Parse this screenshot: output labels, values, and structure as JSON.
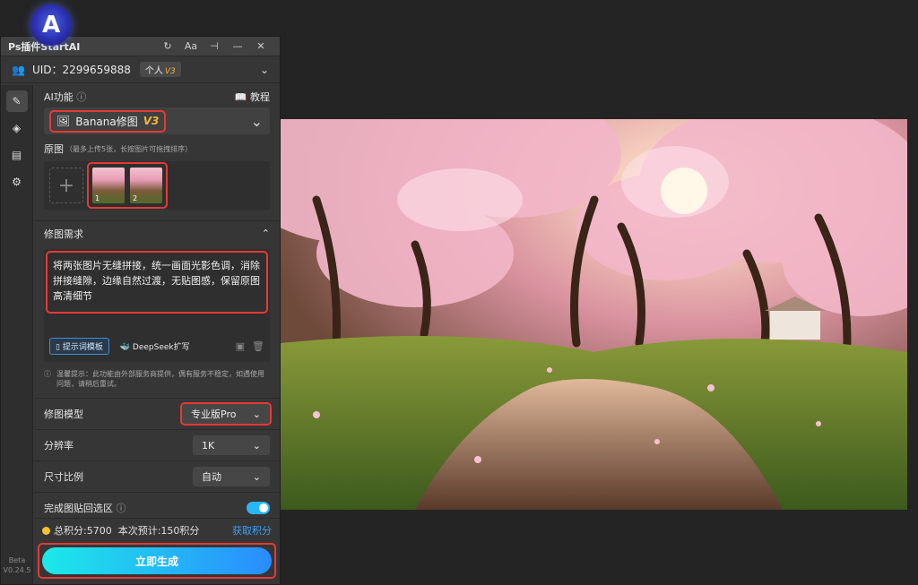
{
  "logo": {
    "letter": "A"
  },
  "window": {
    "title": "Ps插件StartAI"
  },
  "user": {
    "uid": "UID：2299659888",
    "plan": "个人",
    "plan_version": "V3"
  },
  "sidebar": {
    "version_line1": "Beta",
    "version_line2": "V0.24.5"
  },
  "ai": {
    "label": "AI功能",
    "tutorial": "教程",
    "model_name": "Banana修图",
    "model_version": "V3"
  },
  "original": {
    "label": "原图",
    "hint": "（最多上传5张，长按图片可拖拽排序）",
    "thumbs": [
      "1",
      "2"
    ]
  },
  "request": {
    "label": "修图需求",
    "text": "将两张图片无缝拼接，统一画面光影色调，消除拼接缝隙，边缘自然过渡，无贴图感，保留原图高清细节",
    "template_btn": "提示词模板",
    "deepseek_btn": "DeepSeek扩写"
  },
  "tip": {
    "text": "温馨提示：此功能由外部服务商提供，偶有服务不稳定，如遇使用问题，请稍后重试。"
  },
  "options": {
    "model_label": "修图模型",
    "model_value": "专业版Pro",
    "resolution_label": "分辨率",
    "resolution_value": "1K",
    "ratio_label": "尺寸比例",
    "ratio_value": "自动",
    "paste_label": "完成图贴回选区"
  },
  "footer": {
    "total": "总积分:5700",
    "estimate": "本次预计:150积分",
    "get_points": "获取积分",
    "generate": "立即生成"
  },
  "colors": {
    "accent": "#29b6f6",
    "highlight": "#e53935",
    "gold": "#f2b53a"
  }
}
